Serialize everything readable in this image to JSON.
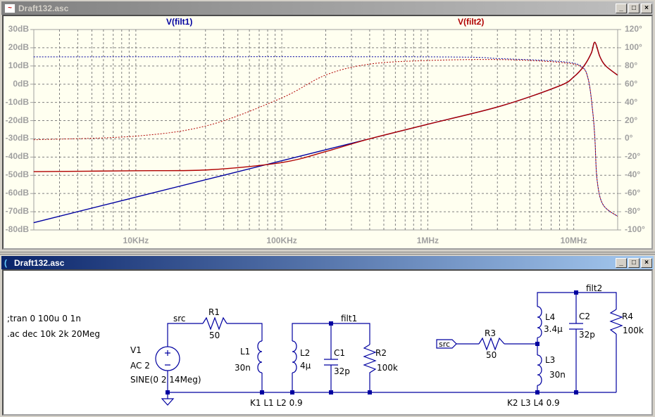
{
  "plot_window": {
    "title": "Draft132.asc",
    "controls": [
      "_",
      "□",
      "×"
    ]
  },
  "schematic_window": {
    "title": "Draft132.asc",
    "controls": [
      "_",
      "□",
      "×"
    ]
  },
  "chart_data": {
    "type": "line",
    "traces": [
      "V(filt1)",
      "V(filt2)"
    ],
    "colors": {
      "V(filt1)": "#0000a0",
      "V(filt2)": "#b00000"
    },
    "x_scale": "log",
    "xlim_hz": [
      2000,
      20000000
    ],
    "x_ticks": [
      "10KHz",
      "100KHz",
      "1MHz",
      "10MHz"
    ],
    "ylim_db": [
      -80,
      30
    ],
    "y_left_ticks": [
      "30dB",
      "20dB",
      "10dB",
      "0dB",
      "-10dB",
      "-20dB",
      "-30dB",
      "-40dB",
      "-50dB",
      "-60dB",
      "-70dB",
      "-80dB"
    ],
    "ylim_phase_deg": [
      -100,
      120
    ],
    "y_right_ticks": [
      "120°",
      "100°",
      "80°",
      "60°",
      "40°",
      "20°",
      "0°",
      "-20°",
      "-40°",
      "-60°",
      "-80°",
      "-100°"
    ],
    "grid": true,
    "series": [
      {
        "name": "V(filt1) magnitude",
        "trace": "V(filt1)",
        "kind": "magnitude_db",
        "log10_hz": [
          3.3,
          4,
          5,
          6,
          6.5,
          6.9,
          7.0,
          7.07,
          7.12,
          7.145,
          7.18,
          7.22,
          7.3
        ],
        "values": [
          -76,
          -62,
          -42,
          -22,
          -12,
          -1,
          4,
          10,
          17,
          23,
          15,
          10,
          5
        ]
      },
      {
        "name": "V(filt2) magnitude",
        "trace": "V(filt2)",
        "kind": "magnitude_db",
        "log10_hz": [
          3.3,
          4,
          4.5,
          5,
          5.3,
          5.6,
          6,
          6.5,
          6.9,
          7.0,
          7.07,
          7.12,
          7.145,
          7.18,
          7.22,
          7.3
        ],
        "values": [
          -48,
          -47.5,
          -47,
          -43,
          -37,
          -30,
          -22,
          -12,
          -1,
          4,
          10,
          17,
          23,
          15,
          10,
          5
        ]
      },
      {
        "name": "V(filt1) phase",
        "trace": "V(filt1)",
        "kind": "phase_deg",
        "log10_hz": [
          3.3,
          6,
          6.5,
          6.9,
          7.05,
          7.1,
          7.13,
          7.145,
          7.16,
          7.2,
          7.3
        ],
        "values": [
          90,
          90,
          88,
          85,
          80,
          65,
          30,
          0,
          -45,
          -72,
          -85
        ]
      },
      {
        "name": "V(filt2) phase",
        "trace": "V(filt2)",
        "kind": "phase_deg",
        "log10_hz": [
          3.3,
          4,
          4.5,
          5,
          5.3,
          5.6,
          6,
          6.5,
          6.9,
          7.05,
          7.1,
          7.13,
          7.145,
          7.16,
          7.2,
          7.3
        ],
        "values": [
          -1,
          3,
          15,
          45,
          70,
          82,
          86,
          87,
          84,
          79,
          65,
          30,
          0,
          -45,
          -72,
          -85
        ]
      }
    ]
  },
  "schematic": {
    "directives": [
      ";tran 0 100u 0 1n",
      ".ac dec 10k 2k 20Meg"
    ],
    "v1": {
      "name": "V1",
      "ac": "AC 2",
      "value": "SINE(0 2 14Meg)"
    },
    "nets": {
      "src": "src",
      "filt1": "filt1",
      "filt2": "filt2",
      "src_flag": "src"
    },
    "r1": {
      "name": "R1",
      "value": "50"
    },
    "l1": {
      "name": "L1",
      "value": "30n"
    },
    "l2": {
      "name": "L2",
      "value": "4µ"
    },
    "c1": {
      "name": "C1",
      "value": "32p"
    },
    "r2": {
      "name": "R2",
      "value": "100k"
    },
    "r3": {
      "name": "R3",
      "value": "50"
    },
    "l3": {
      "name": "L3",
      "value": "30n"
    },
    "l4": {
      "name": "L4",
      "value": "3.4µ"
    },
    "c2": {
      "name": "C2",
      "value": "32p"
    },
    "r4": {
      "name": "R4",
      "value": "100k"
    },
    "k1": "K1 L1 L2 0.9",
    "k2": "K2 L3 L4 0.9"
  }
}
